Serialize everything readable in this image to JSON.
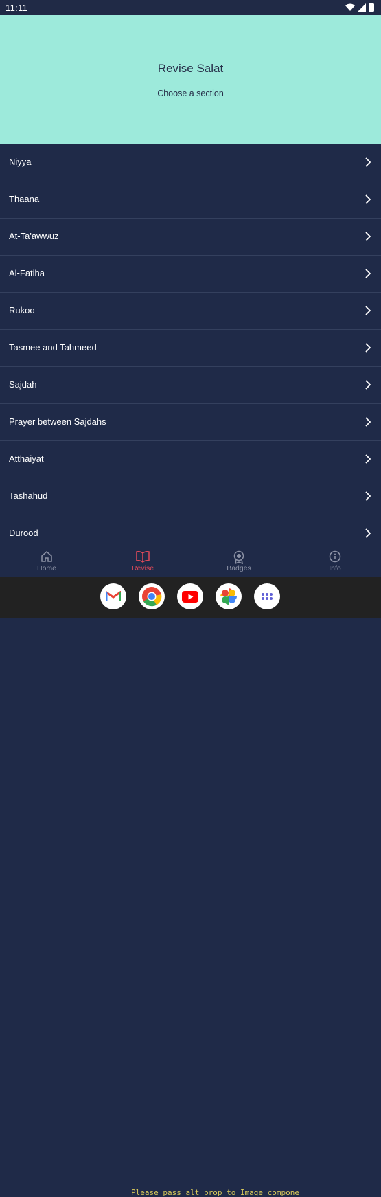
{
  "status_bar": {
    "time": "11:11"
  },
  "header": {
    "title": "Revise Salat",
    "subtitle": "Choose a section"
  },
  "sections": [
    {
      "label": "Niyya"
    },
    {
      "label": "Thaana"
    },
    {
      "label": "At-Ta'awwuz"
    },
    {
      "label": "Al-Fatiha"
    },
    {
      "label": "Rukoo"
    },
    {
      "label": "Tasmee and Tahmeed"
    },
    {
      "label": "Sajdah"
    },
    {
      "label": "Prayer between Sajdahs"
    },
    {
      "label": "Atthaiyat"
    },
    {
      "label": "Tashahud"
    },
    {
      "label": "Durood"
    }
  ],
  "bottom_nav": {
    "items": [
      {
        "label": "Home",
        "icon": "home-icon"
      },
      {
        "label": "Revise",
        "icon": "book-icon",
        "active": true
      },
      {
        "label": "Badges",
        "icon": "badge-icon"
      },
      {
        "label": "Info",
        "icon": "info-icon"
      }
    ]
  },
  "dock": {
    "apps": [
      "gmail-icon",
      "chrome-icon",
      "youtube-icon",
      "photos-icon",
      "app-drawer-icon"
    ]
  },
  "colors": {
    "header_bg": "#9deadb",
    "list_bg": "#1f2a48",
    "active_nav": "#e04a5a"
  },
  "overlay": {
    "console_text": "Please pass alt prop to Image compone"
  }
}
